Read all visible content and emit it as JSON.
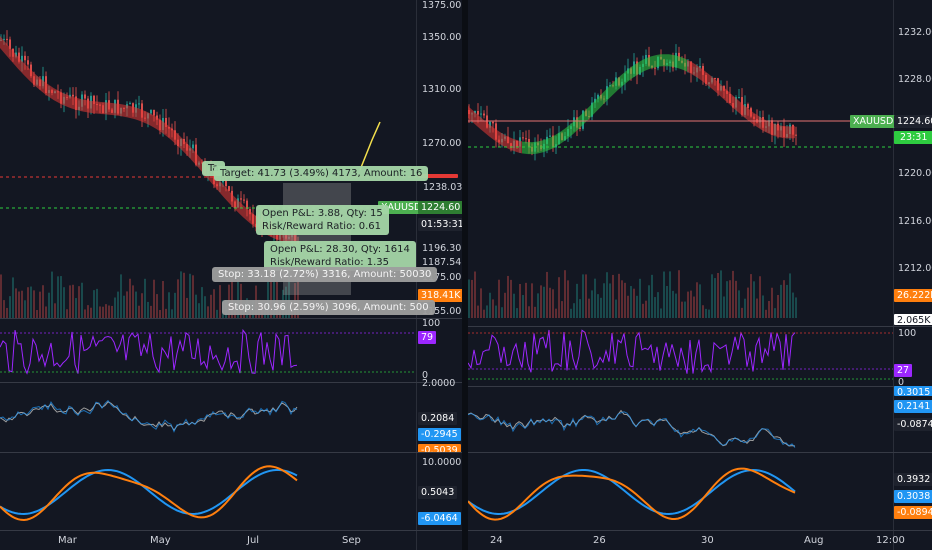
{
  "left": {
    "price_ticks": [
      "1375.00",
      "1350.00",
      "1310.00",
      "1270.00",
      "1238.03",
      "1224.60",
      "1196.30",
      "1187.54",
      "1175.00",
      "1155.00"
    ],
    "price_badges": {
      "level_badge": "1238.03",
      "symbol": "XAUUSD",
      "last": "1224.60",
      "timer": "01:53:31",
      "volume": "318.41K"
    },
    "target_label": "Target: 41.73 (3.49%) 4173, Amount: 16",
    "target_marker": "Ta",
    "pnl1_line1": "Open P&L: 3.88, Qty: 15",
    "pnl1_line2": "Risk/Reward Ratio: 0.61",
    "pnl2_line1": "Open P&L: 28.30, Qty: 1614",
    "pnl2_line2": "Risk/Reward Ratio: 1.35",
    "stop1_label": "Stop: 33.18 (2.72%) 3316, Amount: 50030",
    "stop2_label": "Stop: 30.96 (2.59%) 3096, Amount: 500",
    "rsi_ticks": [
      "100",
      "0"
    ],
    "rsi_value": "79",
    "osc1_ticks": [
      "2.0000"
    ],
    "osc1_values": [
      "0.2084",
      "-0.2945",
      "-0.5039"
    ],
    "osc2_ticks": [
      "10.0000"
    ],
    "osc2_values": [
      "0.5043",
      "-6.0464"
    ],
    "x_labels": [
      "Mar",
      "May",
      "Jul",
      "Sep"
    ]
  },
  "right": {
    "price_ticks": [
      "1232.00",
      "1228.00",
      "1224.60",
      "1220.00",
      "1216.00",
      "1212.00"
    ],
    "price_badges": {
      "symbol": "XAUUSD",
      "last": "1224.60",
      "timer": "23:31",
      "volume": "26.222K",
      "volume2": "2.065K"
    },
    "rsi_ticks": [
      "100",
      "0"
    ],
    "rsi_value": "27",
    "osc1_values": [
      "0.3015",
      "0.2141",
      "-0.0874"
    ],
    "osc2_values": [
      "0.3932",
      "0.3038",
      "-0.0894"
    ],
    "x_labels": [
      "24",
      "26",
      "30",
      "Aug",
      "12:00"
    ]
  },
  "colors": {
    "bg": "#131722",
    "up": "#26a69a",
    "bull": "#2ecc40",
    "bear": "#e53935",
    "rsi": "#9c27ff",
    "blue": "#2196f3",
    "orange": "#ff7f0e",
    "label_green": "#a5d6a7",
    "symbol_badge": "#4caf50"
  }
}
